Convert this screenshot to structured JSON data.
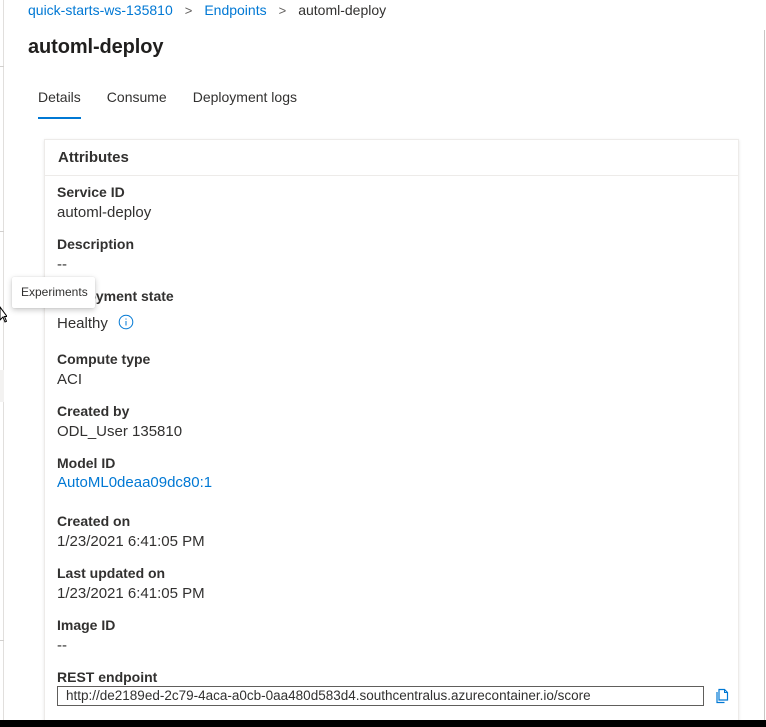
{
  "breadcrumb": {
    "items": [
      "quick-starts-ws-135810",
      "Endpoints"
    ],
    "separator": ">",
    "current": "automl-deploy"
  },
  "page": {
    "title": "automl-deploy"
  },
  "tabs": [
    {
      "label": "Details",
      "active": true
    },
    {
      "label": "Consume",
      "active": false
    },
    {
      "label": "Deployment logs",
      "active": false
    }
  ],
  "card": {
    "header": "Attributes",
    "service_id": {
      "label": "Service ID",
      "value": "automl-deploy"
    },
    "description": {
      "label": "Description",
      "value": "--"
    },
    "deployment_state": {
      "label": "Deployment state",
      "value": "Healthy"
    },
    "compute_type": {
      "label": "Compute type",
      "value": "ACI"
    },
    "created_by": {
      "label": "Created by",
      "value": "ODL_User 135810"
    },
    "model_id": {
      "label": "Model ID",
      "value": "AutoML0deaa09dc80:1"
    },
    "created_on": {
      "label": "Created on",
      "value": "1/23/2021 6:41:05 PM"
    },
    "last_updated_on": {
      "label": "Last updated on",
      "value": "1/23/2021 6:41:05 PM"
    },
    "image_id": {
      "label": "Image ID",
      "value": "--"
    },
    "rest_endpoint": {
      "label": "REST endpoint",
      "value": "http://de2189ed-2c79-4aca-a0cb-0aa480d583d4.southcentralus.azurecontainer.io/score"
    }
  },
  "tooltip": {
    "text": "Experiments"
  },
  "icons": {
    "info": "info-icon",
    "copy": "copy-icon",
    "cursor": "mouse-pointer-icon"
  },
  "colors": {
    "accent": "#0078d4",
    "text": "#323130",
    "border": "#edebe9"
  }
}
